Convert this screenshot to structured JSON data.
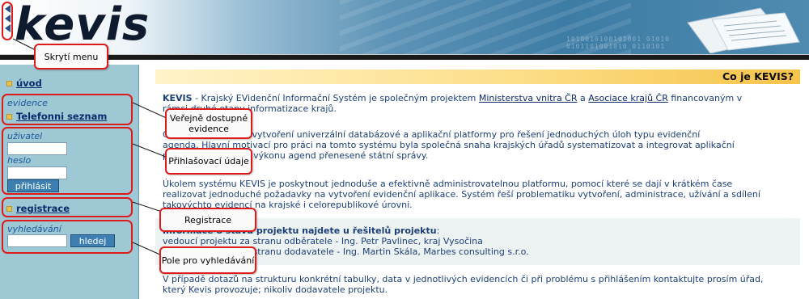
{
  "header": {
    "logo": "kevis",
    "binary": [
      "1010010100101001 01010",
      "0101101001010 0110101"
    ]
  },
  "sidebar": {
    "uvod": "úvod",
    "evidence_label": "evidence",
    "telefonni": "Telefonni seznam",
    "user_label": "uživatel",
    "password_label": "heslo",
    "login_button": "přihlásit",
    "registrace": "registrace",
    "search_label": "vyhledávání",
    "search_button": "hledej"
  },
  "callouts": {
    "hide_menu": "Skrytí menu",
    "public_line1": "Veřejně dostupné",
    "public_line2": "evidence",
    "login": "Přihlašovací údaje",
    "registration": "Registrace",
    "search_field": "Pole pro vyhledávání"
  },
  "content": {
    "title": "Co je KEVIS?",
    "p1_prefix": "KEVIS",
    "p1_a": " - Krajský EVidenční Informační Systém je společným projektem ",
    "p1_link1": "Ministerstva vnitra ČR",
    "p1_b": " a ",
    "p1_link2": "Asociace krajů ČR",
    "p1_c": " financovaným v",
    "p1_line2": "rámci druhé etapy informatizace krajů.",
    "p2_line1": "Cílem projektu bylo vytvoření univerzální databázové a aplikační platformy pro řešení jednoduchých úloh typu evidenční",
    "p2_line2": "agenda. Hlavní motivací pro práci na tomto systému byla společná snaha krajských úřadů systematizovat a integrovat aplikační",
    "p2_line3": "prostředky v oblasti výkonu agend přenesené státní správy.",
    "p3_line1": "Úkolem systému KEVIS je poskytnout jednoduše a efektivně administrovatelnou platformu, pomocí které se dají v krátkém čase",
    "p3_line2": "realizovat jednoduché požadavky na vytvoření evidenční aplikace. Systém řeší problematiku vytvoření, administrace, užívání a sdílení",
    "p3_line3": "takovýchto evidencí na krajské i celorepublikové úrovni.",
    "p4_head": "Informace o stavu projektu najdete u řešitelů projektu",
    "p4_colon": ":",
    "p4_line1": "vedoucí projektu za stranu odběratele - Ing. Petr Pavlinec, kraj Vysočina",
    "p4_line2": "vedoucí projektu za stranu dodavatele - Ing. Martin Skála, Marbes consulting s.r.o.",
    "p5_line1": "V případě dotazů na strukturu konkrétní tabulky, data v jednotlivých evidencích či při problému s přihlášením kontaktujte prosím úřad,",
    "p5_line2": "který Kevis provozuje; nikoliv dodavatele projektu."
  },
  "colors": {
    "highlight": "#dd1b1b",
    "sidebar": "#9ec8d3",
    "title_bar": "#f6c34a"
  }
}
